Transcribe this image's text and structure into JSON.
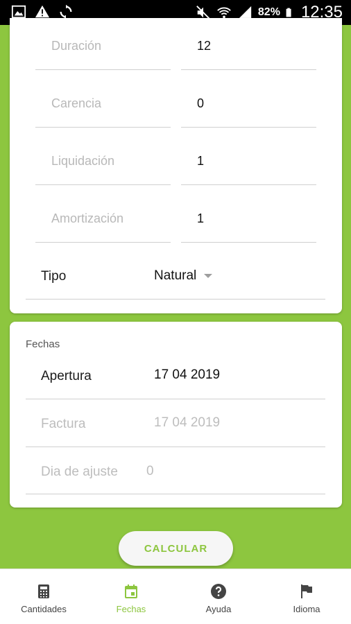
{
  "status_bar": {
    "battery_percent": "82%",
    "time": "12:35",
    "icons": [
      "gallery-icon",
      "warning-icon",
      "sync-icon",
      "mute-icon",
      "wifi-icon",
      "signal-icon",
      "battery-icon"
    ]
  },
  "loan_fields": [
    {
      "label": "Duración",
      "value": "12"
    },
    {
      "label": "Carencia",
      "value": "0"
    },
    {
      "label": "Liquidación",
      "value": "1"
    },
    {
      "label": "Amortización",
      "value": "1"
    }
  ],
  "tipo": {
    "label": "Tipo",
    "value": "Natural"
  },
  "fechas": {
    "title": "Fechas",
    "apertura": {
      "label": "Apertura",
      "value": "17 04 2019"
    },
    "factura": {
      "label": "Factura",
      "value": "17 04 2019"
    },
    "dia_ajuste": {
      "label": "Dia de ajuste",
      "value": "0"
    }
  },
  "calcular_label": "CALCULAR",
  "bottom_nav": [
    {
      "label": "Cantidades",
      "icon": "calculator-icon",
      "active": false
    },
    {
      "label": "Fechas",
      "icon": "calendar-icon",
      "active": true
    },
    {
      "label": "Ayuda",
      "icon": "help-icon",
      "active": false
    },
    {
      "label": "Idioma",
      "icon": "flag-icon",
      "active": false
    }
  ],
  "colors": {
    "accent": "#8dc63f",
    "status_bar": "#000000"
  }
}
